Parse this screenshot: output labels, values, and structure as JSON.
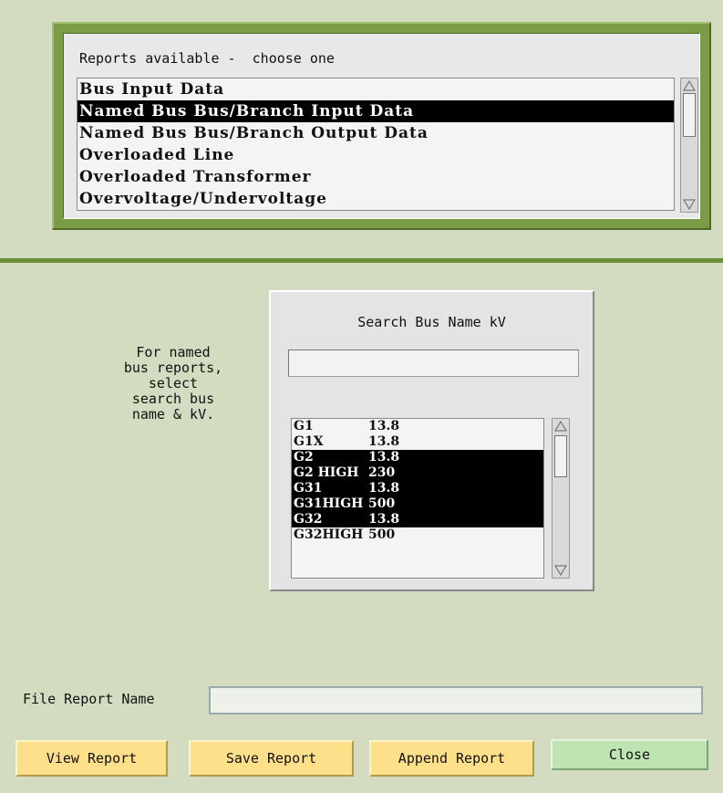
{
  "reports": {
    "label": "Reports available -  choose one",
    "items": [
      {
        "label": "Bus Input Data",
        "selected": false
      },
      {
        "label": "Named Bus Bus/Branch Input Data",
        "selected": true
      },
      {
        "label": "Named Bus Bus/Branch Output Data",
        "selected": false
      },
      {
        "label": "Overloaded Line",
        "selected": false
      },
      {
        "label": "Overloaded Transformer",
        "selected": false
      },
      {
        "label": "Overvoltage/Undervoltage",
        "selected": false
      }
    ]
  },
  "help_text": "For named\nbus reports,\nselect\nsearch bus\nname & kV.",
  "search": {
    "title": "Search Bus Name kV",
    "value": "",
    "buses": [
      {
        "name": "G1",
        "kv": "13.8",
        "selected": false
      },
      {
        "name": "G1X",
        "kv": "13.8",
        "selected": false
      },
      {
        "name": "G2",
        "kv": "13.8",
        "selected": true
      },
      {
        "name": "G2 HIGH",
        "kv": "230",
        "selected": true
      },
      {
        "name": "G31",
        "kv": "13.8",
        "selected": true
      },
      {
        "name": "G31HIGH",
        "kv": "500",
        "selected": true
      },
      {
        "name": "G32",
        "kv": "13.8",
        "selected": true
      },
      {
        "name": "G32HIGH",
        "kv": "500",
        "selected": false
      }
    ]
  },
  "file": {
    "label": "File Report Name",
    "value": ""
  },
  "buttons": {
    "view": "View Report",
    "save": "Save Report",
    "append": "Append Report",
    "close": "Close"
  },
  "colors": {
    "background": "#d3dcc0",
    "frame": "#7a9c47",
    "button_yellow": "#ffe08a",
    "button_green": "#bde4b2",
    "selection": "#000000"
  }
}
